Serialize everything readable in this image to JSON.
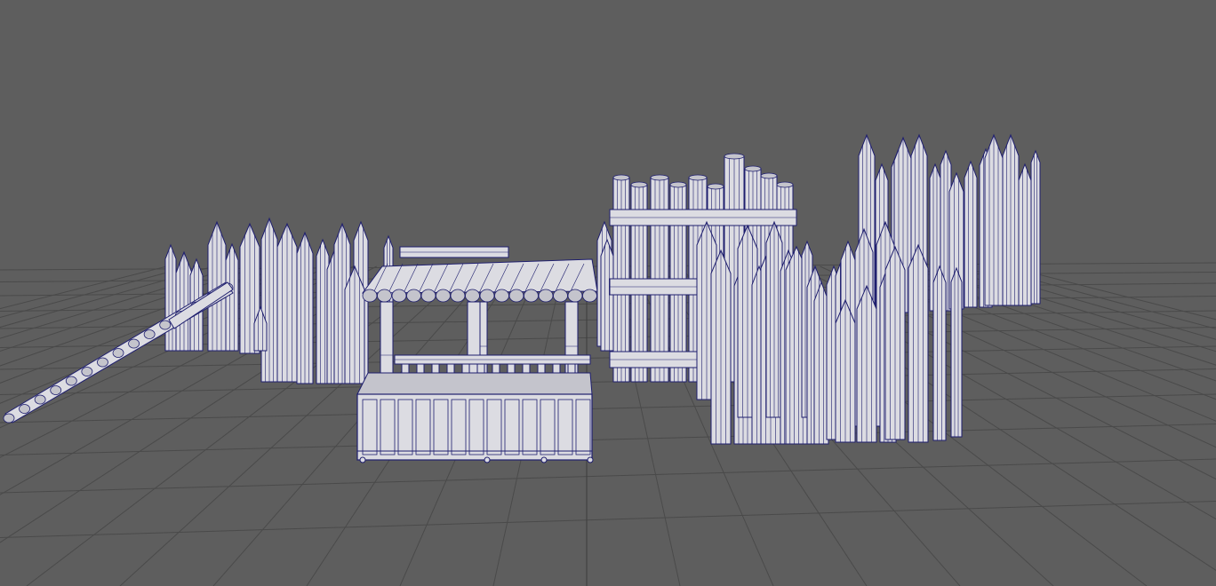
{
  "viewport": {
    "mode": "wireframe-on-shaded",
    "grid_visible": true,
    "colors": {
      "background": "#5e5e5e",
      "grid_line": "#4a4a4a",
      "grid_axis": "#3c3c3c",
      "mesh_fill": "#dcdce2",
      "mesh_shade": "#c4c4cc",
      "wire": "#1e1e6e"
    }
  },
  "scene": {
    "objects": [
      "left-palisade-wall",
      "fallen-log",
      "roofed-pen",
      "gate-tower",
      "right-palisade-wall",
      "back-palisade-wall"
    ]
  }
}
